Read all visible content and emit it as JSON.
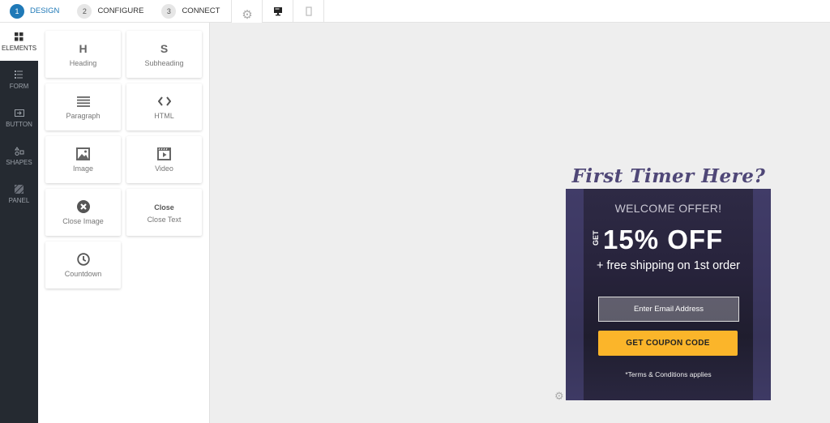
{
  "steps": [
    {
      "num": "1",
      "label": "DESIGN",
      "active": true
    },
    {
      "num": "2",
      "label": "CONFIGURE",
      "active": false
    },
    {
      "num": "3",
      "label": "CONNECT",
      "active": false
    }
  ],
  "toolbar": {
    "icons": [
      "gear-icon",
      "desktop-icon",
      "mobile-icon"
    ]
  },
  "nav": [
    {
      "label": "ELEMENTS",
      "icon": "grid-icon"
    },
    {
      "label": "FORM",
      "icon": "form-icon"
    },
    {
      "label": "BUTTON",
      "icon": "button-icon"
    },
    {
      "label": "SHAPES",
      "icon": "shapes-icon"
    },
    {
      "label": "PANEL",
      "icon": "panel-icon"
    }
  ],
  "elements": [
    {
      "label": "Heading",
      "glyph": "H"
    },
    {
      "label": "Subheading",
      "glyph": "S"
    },
    {
      "label": "Paragraph"
    },
    {
      "label": "HTML"
    },
    {
      "label": "Image"
    },
    {
      "label": "Video"
    },
    {
      "label": "Close Image"
    },
    {
      "label": "Close Text",
      "glyph": "Close"
    },
    {
      "label": "Countdown"
    }
  ],
  "popup": {
    "headline": "First Timer Here?",
    "welcome": "WELCOME OFFER!",
    "get": "GET",
    "discount": "15% OFF",
    "shipping": "+ free shipping on 1st order",
    "email_placeholder": "Enter Email Address",
    "cta": "GET COUPON CODE",
    "terms": "*Terms & Conditions applies"
  },
  "colors": {
    "accent": "#1f79b7",
    "cta": "#fbb52a",
    "headline": "#4f4777"
  }
}
